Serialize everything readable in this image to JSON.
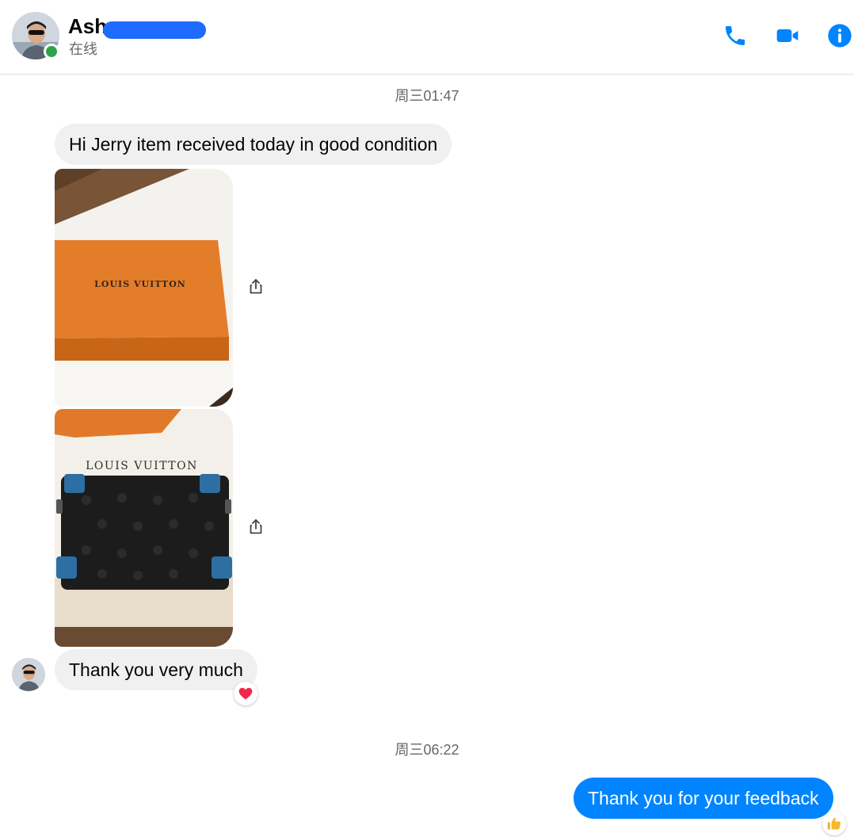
{
  "header": {
    "contact_name": "Ash",
    "status": "在线",
    "call_icon": "phone-icon",
    "video_icon": "video-camera-icon",
    "info_icon": "info-icon",
    "accent_color": "#0084ff",
    "online_color": "#31a24c"
  },
  "conversation": {
    "timestamp_1": "周三01:47",
    "msg_1": "Hi Jerry item received today in good condition",
    "photo_1_logo": "LOUIS VUITTON",
    "photo_2_logo": "LOUIS VUITTON",
    "share_icon": "share-icon",
    "msg_2": "Thank you very much",
    "msg_2_reaction": "heart-icon",
    "timestamp_2": "周三06:22",
    "msg_3": "Thank you for your feedback",
    "msg_3_reaction": "thumbs-up-icon"
  }
}
